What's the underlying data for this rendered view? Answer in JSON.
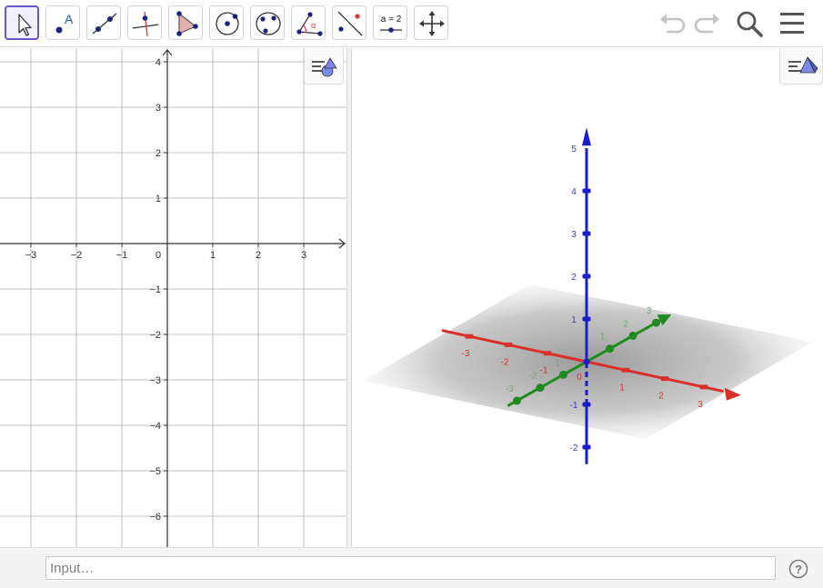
{
  "toolbar": {
    "tools": [
      {
        "id": "move",
        "label": "Move",
        "icon": "arrow-cursor-icon",
        "selected": true
      },
      {
        "id": "point",
        "label": "Point",
        "icon": "point-with-label-icon",
        "glyph": "A"
      },
      {
        "id": "line",
        "label": "Line",
        "icon": "line-through-points-icon"
      },
      {
        "id": "perpendicular",
        "label": "Perpendicular Line",
        "icon": "perpendicular-line-icon"
      },
      {
        "id": "polygon",
        "label": "Polygon",
        "icon": "polygon-icon"
      },
      {
        "id": "circle-center",
        "label": "Circle with Center",
        "icon": "circle-center-point-icon"
      },
      {
        "id": "circle-three",
        "label": "Circle through 3 Points",
        "icon": "circle-three-points-icon"
      },
      {
        "id": "angle",
        "label": "Angle",
        "icon": "angle-icon",
        "glyph": "α"
      },
      {
        "id": "reflect",
        "label": "Reflect about Line",
        "icon": "reflect-icon"
      },
      {
        "id": "slider",
        "label": "Slider",
        "icon": "slider-icon",
        "glyph": "a = 2"
      },
      {
        "id": "move-view",
        "label": "Move Graphics View",
        "icon": "move-graphics-view-icon"
      }
    ],
    "right": [
      "undo-icon",
      "redo-icon",
      "search-icon",
      "menu-icon"
    ]
  },
  "graphics2d": {
    "x_ticks": [
      "−3",
      "−2",
      "−1",
      "0",
      "1",
      "2",
      "3"
    ],
    "x_values": [
      -3,
      -2,
      -1,
      0,
      1,
      2,
      3
    ],
    "y_ticks": [
      "4",
      "3",
      "2",
      "1",
      "−1",
      "−2",
      "−3",
      "−4",
      "−5",
      "−6"
    ],
    "y_values": [
      4,
      3,
      2,
      1,
      -1,
      -2,
      -3,
      -4,
      -5,
      -6
    ],
    "grid": true,
    "style_button_icon": "style-bar-icon"
  },
  "graphics3d": {
    "x_labels": [
      "-3",
      "-2",
      "-1",
      "1",
      "2",
      "3"
    ],
    "x_values": [
      -3,
      -2,
      -1,
      1,
      2,
      3
    ],
    "y_labels": [
      "-3",
      "-2",
      "-1",
      "1",
      "2",
      "3"
    ],
    "y_values": [
      -3,
      -2,
      -1,
      1,
      2,
      3
    ],
    "z_labels": [
      "5",
      "4",
      "3",
      "2",
      "1",
      "-1",
      "-2"
    ],
    "z_values": [
      5,
      4,
      3,
      2,
      1,
      -1,
      -2
    ],
    "origin_label": "0",
    "colors": {
      "x": "#d9302c",
      "y": "#1f8a1f",
      "z": "#1c1cc8",
      "plane": "#8a8a8a"
    },
    "style_button_icon": "style-bar-3d-icon"
  },
  "input_bar": {
    "placeholder": "Input…",
    "help_icon": "help-icon"
  }
}
